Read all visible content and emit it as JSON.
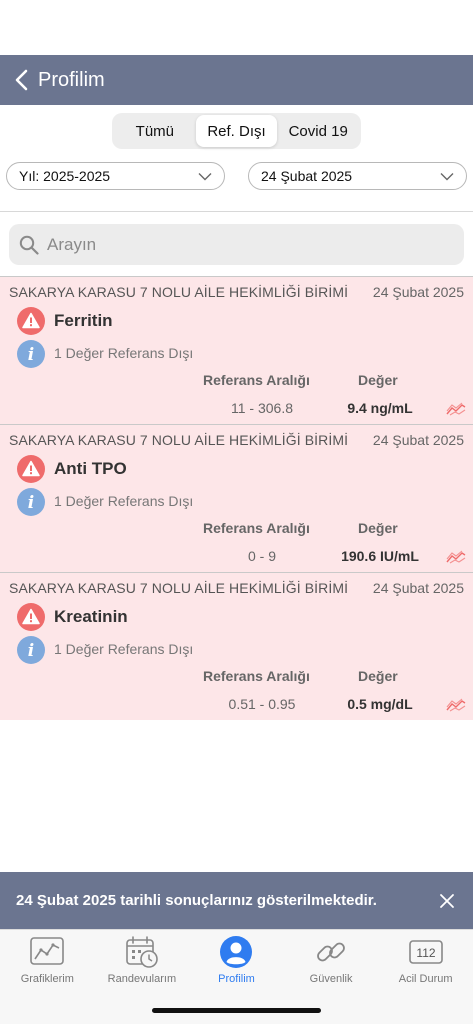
{
  "nav": {
    "title": "Profilim"
  },
  "segments": [
    {
      "label": "Tümü",
      "active": false
    },
    {
      "label": "Ref. Dışı",
      "active": true
    },
    {
      "label": "Covid 19",
      "active": false
    }
  ],
  "filters": {
    "year": "Yıl: 2025-2025",
    "date": "24 Şubat 2025"
  },
  "search": {
    "placeholder": "Arayın"
  },
  "results": [
    {
      "org": "SAKARYA KARASU 7 NOLU AİLE HEKİMLİĞİ BİRİMİ",
      "date": "24 Şubat 2025",
      "name": "Ferritin",
      "out_of_range": "1 Değer Referans Dışı",
      "ref_header": "Referans Aralığı",
      "val_header": "Değer",
      "ref_range": "11 - 306.8",
      "value": "9.4 ng/mL"
    },
    {
      "org": "SAKARYA KARASU 7 NOLU AİLE HEKİMLİĞİ BİRİMİ",
      "date": "24 Şubat 2025",
      "name": "Anti TPO",
      "out_of_range": "1 Değer Referans Dışı",
      "ref_header": "Referans Aralığı",
      "val_header": "Değer",
      "ref_range": "0 - 9",
      "value": "190.6 IU/mL"
    },
    {
      "org": "SAKARYA KARASU 7 NOLU AİLE HEKİMLİĞİ BİRİMİ",
      "date": "24 Şubat 2025",
      "name": "Kreatinin",
      "out_of_range": "1 Değer Referans Dışı",
      "ref_header": "Referans Aralığı",
      "val_header": "Değer",
      "ref_range": "0.51 - 0.95",
      "value": "0.5 mg/dL"
    }
  ],
  "toast": {
    "text": "24 Şubat 2025 tarihli sonuçlarınız gösterilmektedir."
  },
  "tabs": [
    {
      "label": "Grafiklerim",
      "icon": "chart-icon"
    },
    {
      "label": "Randevularım",
      "icon": "calendar-clock-icon"
    },
    {
      "label": "Profilim",
      "icon": "profile-icon",
      "active": true
    },
    {
      "label": "Güvenlik",
      "icon": "link-icon"
    },
    {
      "label": "Acil Durum",
      "icon": "emergency-112-icon",
      "badge": "112"
    }
  ],
  "colors": {
    "header": "#6b7590",
    "alert_bg": "#fde6e8",
    "warning": "#ef6b6b",
    "info": "#7fa9dc",
    "accent": "#2f7cf0"
  }
}
